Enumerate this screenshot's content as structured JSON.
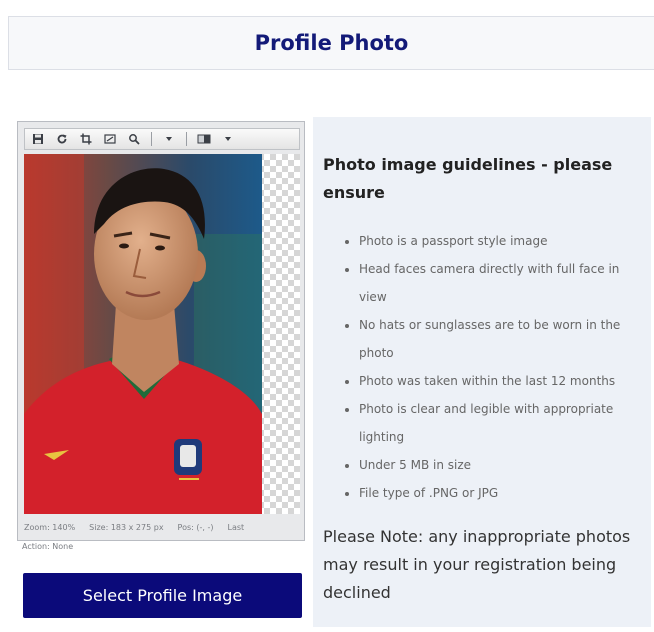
{
  "header": {
    "title": "Profile Photo"
  },
  "editor": {
    "toolbar_icons": [
      "save-icon",
      "rotate-icon",
      "crop-icon",
      "resize-icon",
      "zoom-icon",
      "dropdown-arrow-icon",
      "layers-icon",
      "dropdown-arrow-icon"
    ],
    "status": {
      "zoom": "Zoom: 140%",
      "size": "Size: 183 x 275 px",
      "pos": "Pos: (-, -)",
      "last": "Last"
    },
    "action": "Action: None"
  },
  "select_button": {
    "label": "Select Profile Image"
  },
  "guidelines": {
    "title": "Photo image guidelines - please ensure",
    "items": [
      "Photo is a passport style image",
      "Head faces camera directly with full face in view",
      "No hats or sunglasses are to be worn in the photo",
      "Photo was taken within the last 12 months",
      "Photo is clear and legible with appropriate lighting",
      "Under 5 MB in size",
      "File type of .PNG or JPG"
    ],
    "note": "Please Note: any inappropriate photos may result in your registration being declined"
  },
  "colors": {
    "header_title": "#131a78",
    "button_bg": "#0b0a7a",
    "guidelines_bg": "#edf1f7"
  }
}
